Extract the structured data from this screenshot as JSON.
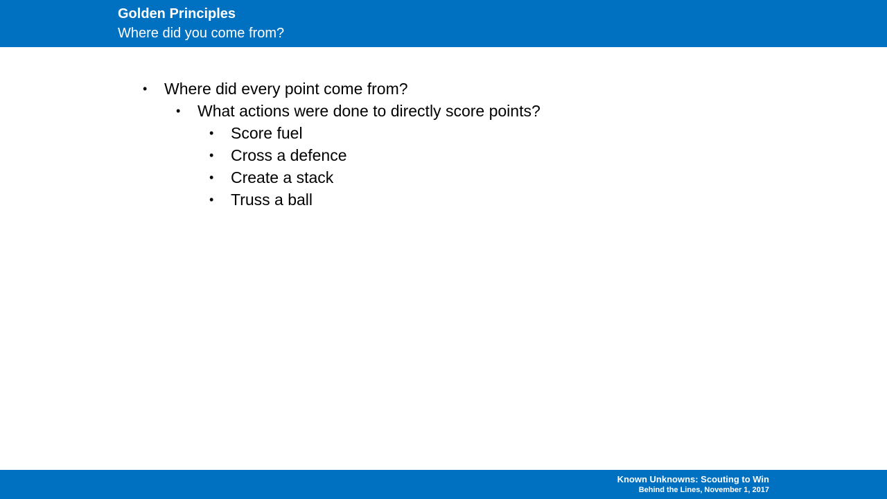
{
  "header": {
    "title": "Golden Principles",
    "subtitle": "Where did you come from?"
  },
  "bullets": {
    "level1": "Where did every point come from?",
    "level2": "What actions were done to directly score points?",
    "level3": [
      "Score fuel",
      "Cross a defence",
      "Create a stack",
      "Truss a ball"
    ],
    "marker": "•"
  },
  "footer": {
    "line1": "Known Unknowns: Scouting to Win",
    "line2": "Behind the Lines, November 1, 2017"
  },
  "colors": {
    "brand_blue": "#0070C0",
    "text": "#000000",
    "header_text": "#ffffff"
  }
}
